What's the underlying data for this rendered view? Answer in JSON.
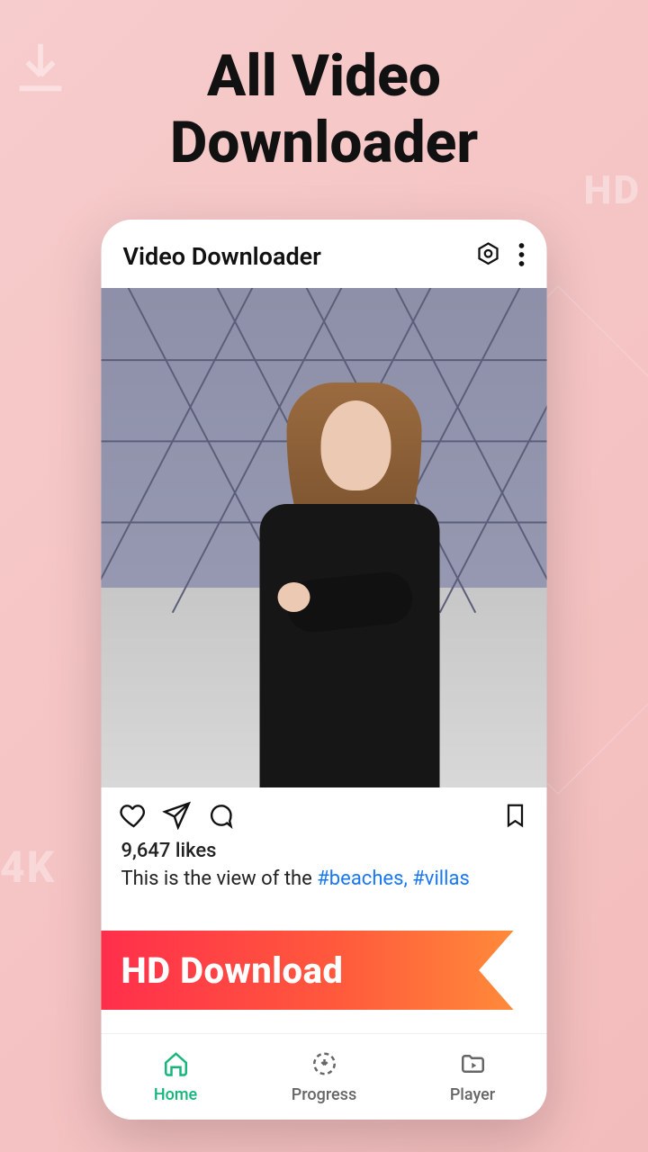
{
  "hero": {
    "title_line1": "All Video",
    "title_line2": "Downloader"
  },
  "bg": {
    "hd": "HD",
    "fourk": "4K"
  },
  "appbar": {
    "title": "Video Downloader"
  },
  "post": {
    "likes": "9,647 likes",
    "caption_text": "This is the view of the ",
    "hashtag1": "#beaches,",
    "hashtag2": "#villas"
  },
  "banner": {
    "label": "HD Download"
  },
  "nav": {
    "home": "Home",
    "progress": "Progress",
    "player": "Player"
  },
  "colors": {
    "accent": "#15b67a",
    "banner_start": "#ff2b4d",
    "banner_end": "#ff8a3a",
    "link": "#1877f2"
  },
  "icons": {
    "settings": "settings-hexagon",
    "more": "more-vertical",
    "heart": "heart",
    "send": "paper-plane",
    "comment": "chat-bubble",
    "bookmark": "bookmark",
    "home": "home",
    "progress": "download-circle",
    "player": "folder-play"
  }
}
